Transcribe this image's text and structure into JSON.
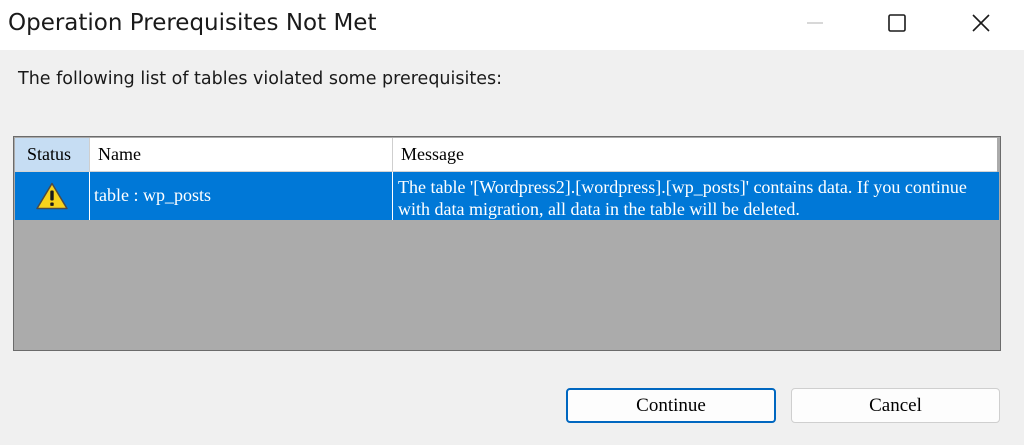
{
  "window": {
    "title": "Operation Prerequisites Not Met"
  },
  "prompt": "The following list of tables violated some prerequisites:",
  "table": {
    "columns": [
      "Status",
      "Name",
      "Message"
    ],
    "rows": [
      {
        "status_icon": "warning-icon",
        "name": "table : wp_posts",
        "message": "The table '[Wordpress2].[wordpress].[wp_posts]' contains data. If you continue with data migration, all data in the table will be deleted."
      }
    ]
  },
  "buttons": {
    "continue": "Continue",
    "cancel": "Cancel"
  },
  "colors": {
    "selection": "#0078d7",
    "empty_area": "#ababab",
    "status_header": "#c6ddf3",
    "default_button_border": "#0067c0"
  }
}
